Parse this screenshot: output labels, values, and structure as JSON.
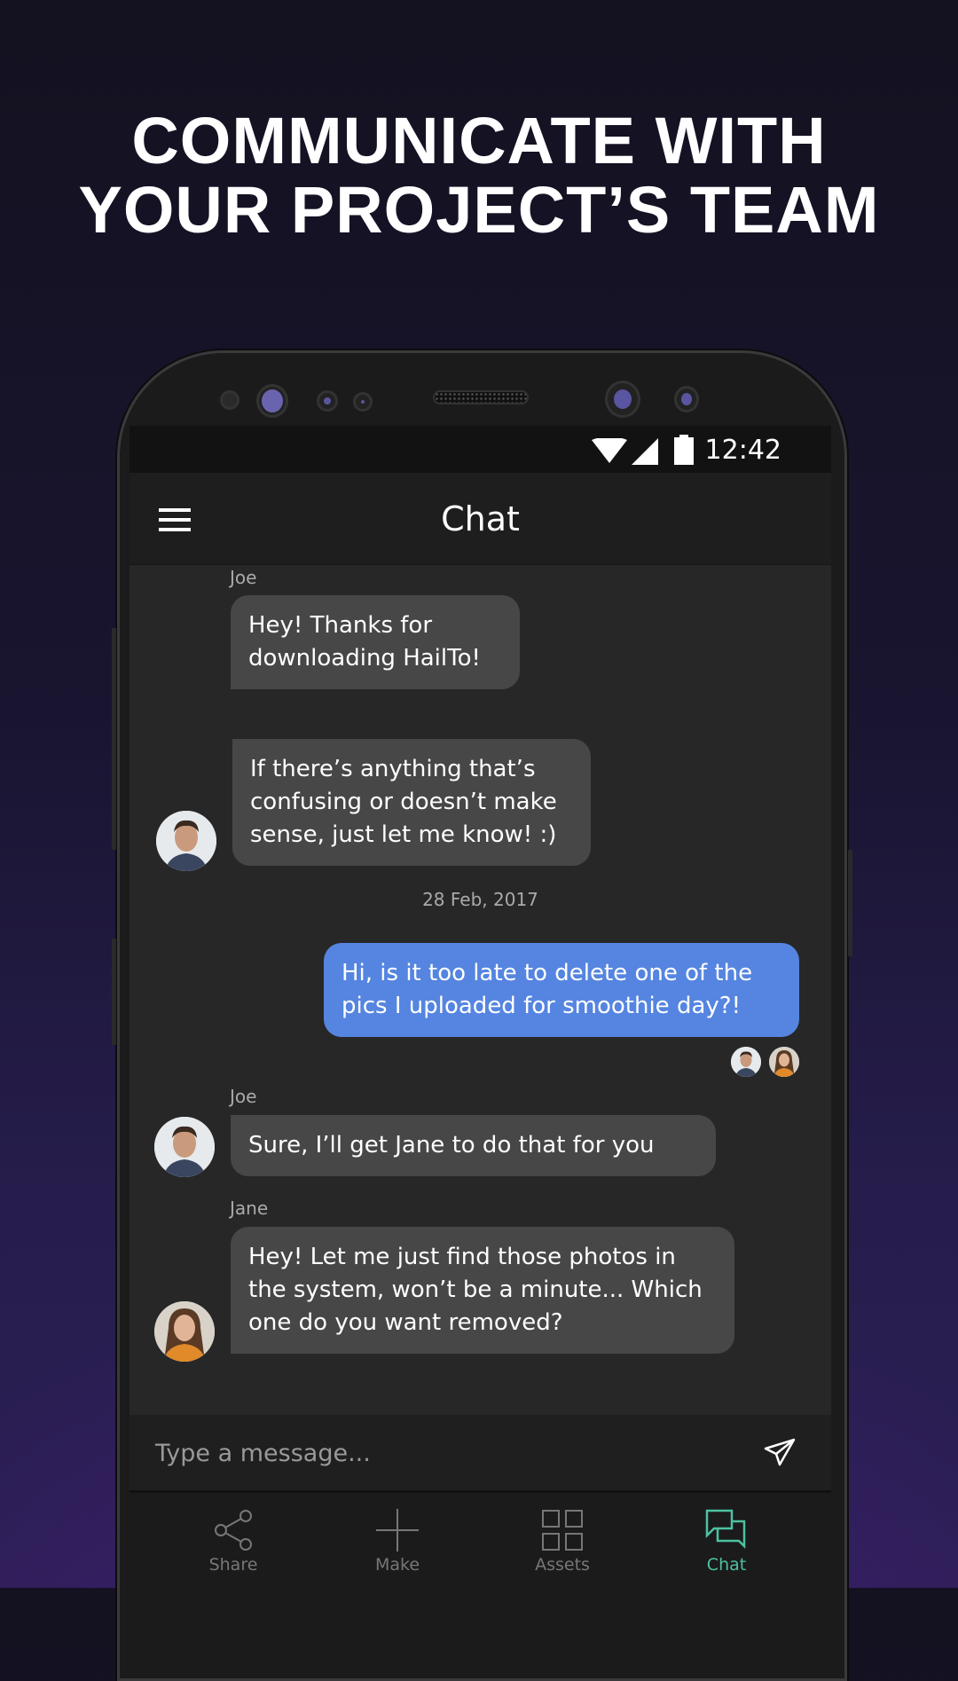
{
  "headline": {
    "line1": "COMMUNICATE WITH",
    "line2": "YOUR PROJECT’S TEAM"
  },
  "status_bar": {
    "time": "12:42",
    "icons": [
      "wifi-icon",
      "signal-icon",
      "battery-icon"
    ]
  },
  "app_bar": {
    "title": "Chat",
    "menu_icon": "hamburger-menu-icon"
  },
  "messages": [
    {
      "sender": "Joe",
      "text": "Hey! Thanks for downloading HailTo!"
    },
    {
      "sender": "Joe",
      "text": "If there’s anything that’s confusing or doesn’t make sense, just let me know! :)"
    },
    {
      "date": "28 Feb, 2017"
    },
    {
      "sender": "me",
      "text": "Hi, is it too late to delete one of the pics I uploaded for smoothie day?!"
    },
    {
      "sender": "Joe",
      "text": "Sure, I’ll get Jane to do that for you"
    },
    {
      "sender": "Jane",
      "text": "Hey! Let me just find those photos in the system, won’t be a minute... Which one do you want removed?"
    }
  ],
  "composer": {
    "placeholder": "Type a message...",
    "send_icon": "paper-plane-icon"
  },
  "nav": {
    "items": [
      {
        "label": "Share",
        "icon": "share-icon"
      },
      {
        "label": "Make",
        "icon": "plus-icon"
      },
      {
        "label": "Assets",
        "icon": "grid-icon"
      },
      {
        "label": "Chat",
        "icon": "chat-bubbles-icon",
        "active": true
      }
    ]
  },
  "colors": {
    "accent": "#4cc2a0",
    "outgoing_bubble": "#5585e0",
    "incoming_bubble": "#474748"
  }
}
